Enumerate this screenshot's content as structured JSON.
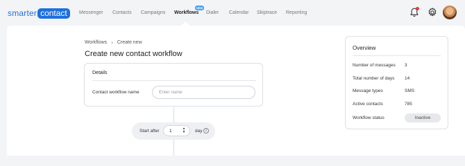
{
  "brand": {
    "name_part1": "smarter",
    "name_part2": "contact"
  },
  "nav": {
    "items": [
      {
        "label": "Messenger"
      },
      {
        "label": "Contacts"
      },
      {
        "label": "Campaigns"
      },
      {
        "label": "Workflows",
        "active": true,
        "badge": "NEW"
      },
      {
        "label": "Dialer"
      },
      {
        "label": "Calendar"
      },
      {
        "label": "Skiptrace"
      },
      {
        "label": "Reporting"
      }
    ],
    "notification_icon": "bell-icon",
    "settings_icon": "gear-icon",
    "accent_color": "#1d6fe0",
    "notification_dot_color": "#e53935"
  },
  "breadcrumb": {
    "parent": "Workflows",
    "current": "Create new"
  },
  "page_title": "Create new contact workflow",
  "details": {
    "title": "Details",
    "name_label": "Contact workflow name",
    "name_placeholder": "Enter name",
    "name_value": ""
  },
  "start": {
    "label": "Start after",
    "value": "1",
    "unit": "day",
    "info_icon": "info-icon"
  },
  "overview": {
    "title": "Overview",
    "rows": [
      {
        "label": "Number of messages",
        "value": "3"
      },
      {
        "label": "Total number of days",
        "value": "14"
      },
      {
        "label": "Message types",
        "value": "SMS"
      },
      {
        "label": "Active contacts",
        "value": "785"
      }
    ],
    "status_label": "Workflow status",
    "status_value": "Inactive"
  }
}
